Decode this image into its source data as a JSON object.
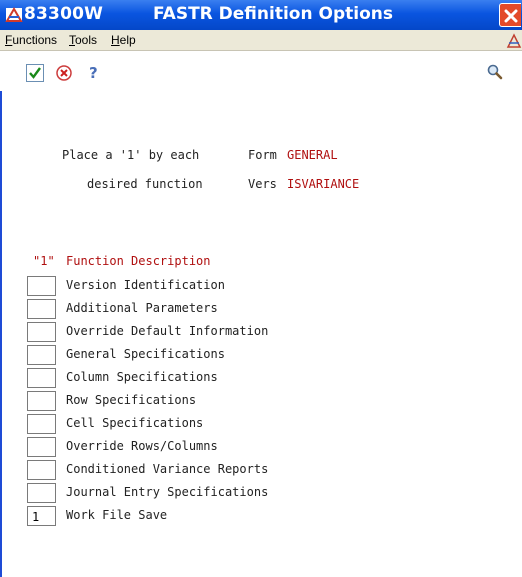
{
  "window": {
    "code": "83300W",
    "title": "FASTR Definition Options"
  },
  "menu": [
    {
      "label": "Functions"
    },
    {
      "label": "Tools"
    },
    {
      "label": "Help"
    }
  ],
  "toolbar": {
    "ok_icon": "check-icon",
    "cancel_icon": "cancel-icon",
    "help_icon": "question-icon",
    "search_icon": "magnifier-icon"
  },
  "form": {
    "instruction_line1": "Place a '1' by each",
    "instruction_line2": "desired function",
    "form_label": "Form",
    "form_value": "GENERAL",
    "vers_label": "Vers",
    "vers_value": "ISVARIANCE"
  },
  "table": {
    "header_col1": "\"1\"",
    "header_col2": "Function Description",
    "rows": [
      {
        "value": "",
        "description": "Version Identification"
      },
      {
        "value": "",
        "description": "Additional Parameters"
      },
      {
        "value": "",
        "description": "Override Default Information"
      },
      {
        "value": "",
        "description": "General Specifications"
      },
      {
        "value": "",
        "description": "Column Specifications"
      },
      {
        "value": "",
        "description": "Row Specifications"
      },
      {
        "value": "",
        "description": "Cell Specifications"
      },
      {
        "value": "",
        "description": "Override Rows/Columns"
      },
      {
        "value": "",
        "description": "Conditioned Variance Reports"
      },
      {
        "value": "",
        "description": "Journal Entry Specifications"
      },
      {
        "value": "1",
        "description": "Work File Save"
      }
    ]
  },
  "colors": {
    "titlebar": "#0a55e0",
    "accent_red": "#b01010",
    "menubar": "#ece9d8"
  }
}
